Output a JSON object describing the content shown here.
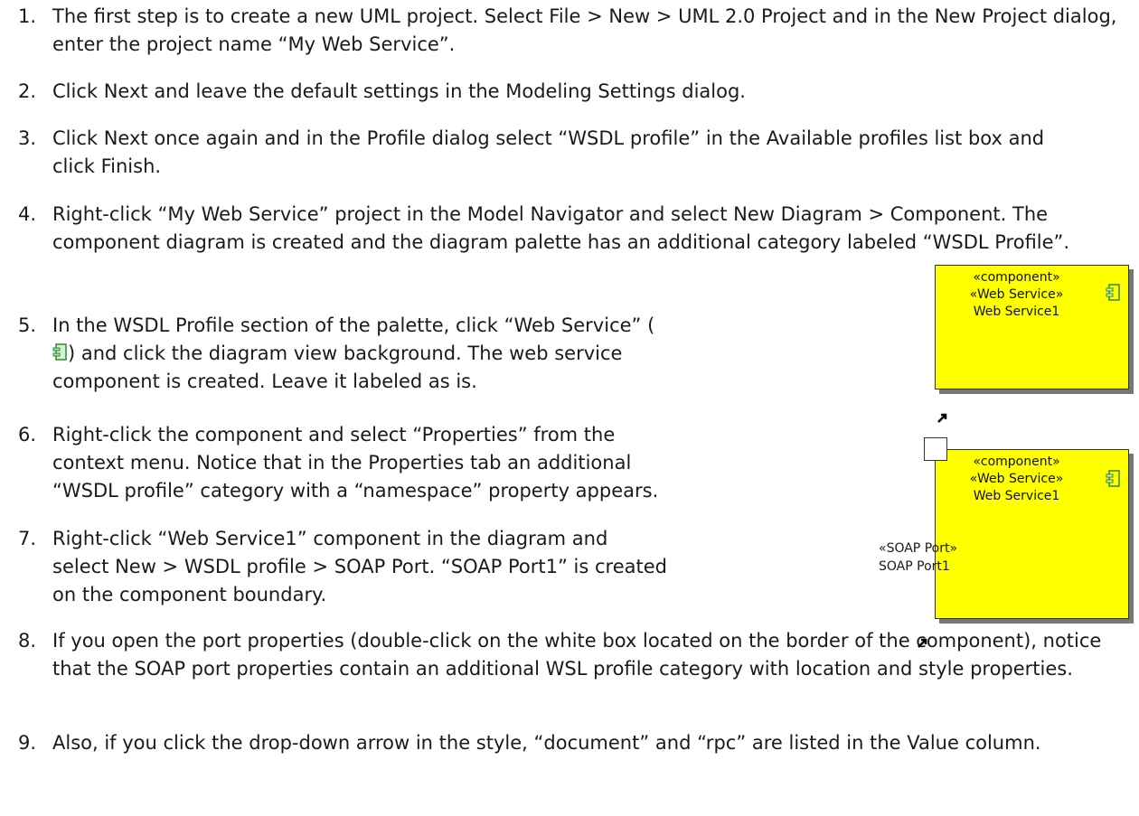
{
  "steps": [
    {
      "num": "1.",
      "parts": [
        "The first step is to create a new UML project.  Select ",
        "File > New > UML 2.0 Project",
        " and in the New Project dialog, enter the project name “My Web Service”."
      ]
    },
    {
      "num": "2.",
      "parts": [
        "Click ",
        "Next",
        " and leave the default settings in the Modeling Settings dialog."
      ]
    },
    {
      "num": "3.",
      "parts": [
        "Click ",
        "Next",
        " once again and in the Profile dialog select “WSDL profile” in the Available profiles list box and click ",
        "Finish",
        "."
      ]
    },
    {
      "num": "4.",
      "parts": [
        "Right-click “My Web Service” project in the Model Navigator and select ",
        "New Diagram > Component",
        ". The component diagram is created and the diagram palette has an additional category labeled “WSDL Profile”."
      ]
    },
    {
      "num": "5.",
      "parts": [
        "In the WSDL Profile section of the palette, click “Web Service” (",
        ") and click the diagram view background.  The web service component is created.  Leave it labeled as is."
      ]
    },
    {
      "num": "6.",
      "parts": [
        "Right-click the component and select “Properties” from the context menu.  Notice that in the Properties tab an additional “WSDL profile” category with a “namespace” property appears."
      ]
    },
    {
      "num": "7.",
      "parts": [
        "Right-click “Web Service1” component in the diagram and select ",
        "New > WSDL profile > SOAP Port",
        ".  “SOAP Port1” is created on the component boundary."
      ]
    },
    {
      "num": "8.",
      "parts": [
        "If you open the port properties (double-click on the white box located on the border of the component), notice that the SOAP port properties contain an additional WSL profile category with location and style properties."
      ]
    },
    {
      "num": "9.",
      "parts": [
        "Also, if you click the drop-down arrow in the style, “document” and “rpc” are listed in the Value column."
      ]
    }
  ],
  "figure1": {
    "stereotype": "«component»",
    "stereotype2": "«Web Service»",
    "name": "Web Service1",
    "icon": "component-icon",
    "fill": "#ffff00"
  },
  "figure2": {
    "stereotype": "«component»",
    "stereotype2": "«Web Service»",
    "name": "Web Service1",
    "port_stereotype": "«SOAP Port»",
    "port_name": "SOAP Port1",
    "icon": "component-icon",
    "fill": "#ffff00"
  }
}
